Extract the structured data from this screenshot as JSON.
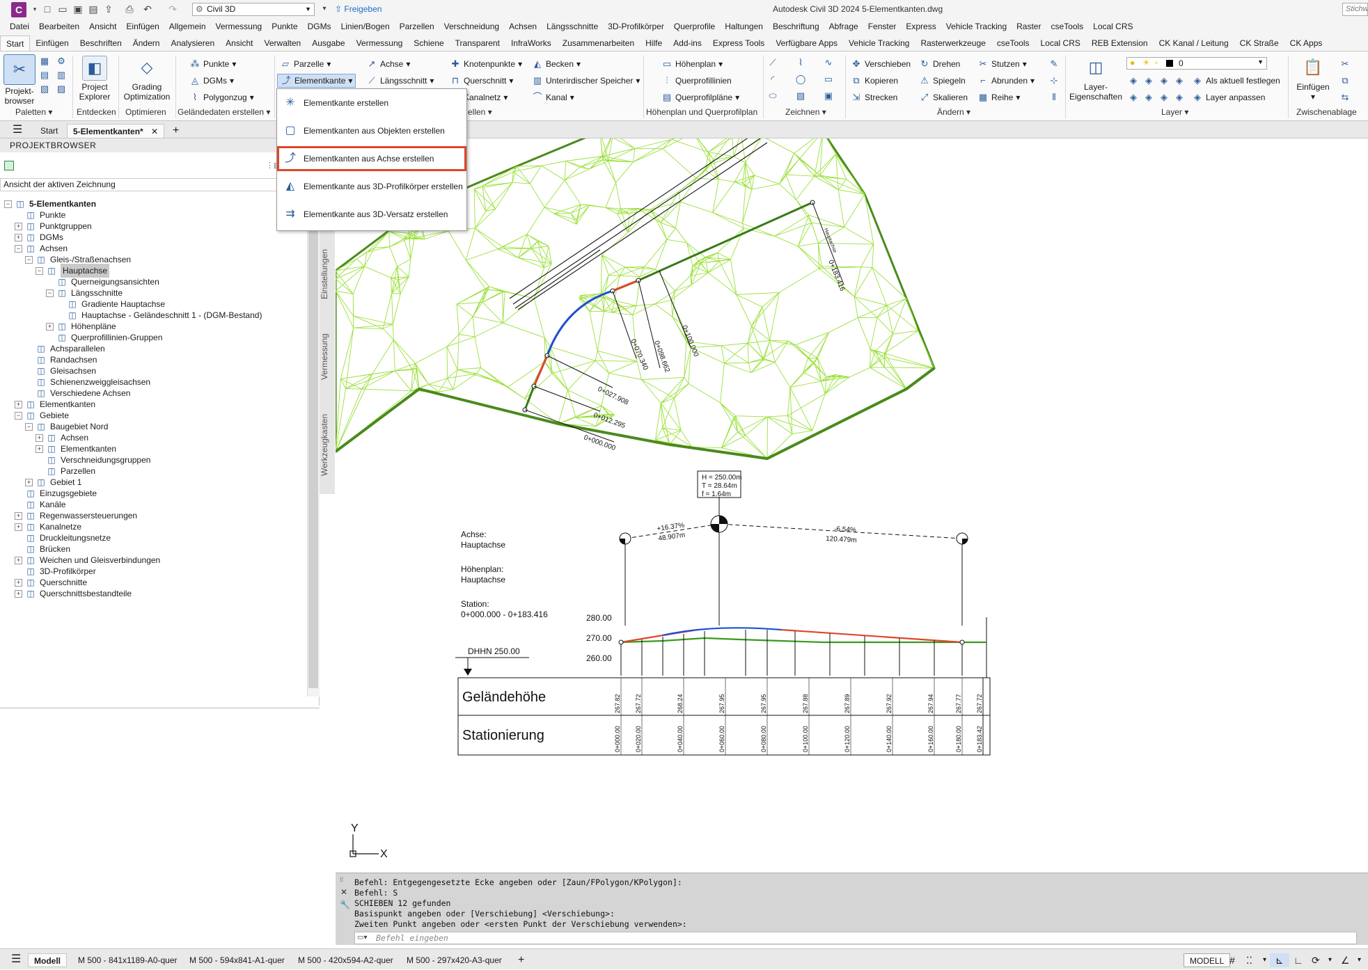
{
  "app": {
    "logo": "C",
    "workspace": "Civil 3D",
    "share_label": "Freigeben",
    "window_title": "Autodesk Civil 3D 2024   5-Elementkanten.dwg",
    "help_search_placeholder": "Stichwo"
  },
  "menubar": [
    "Datei",
    "Bearbeiten",
    "Ansicht",
    "Einfügen",
    "Allgemein",
    "Vermessung",
    "Punkte",
    "DGMs",
    "Linien/Bogen",
    "Parzellen",
    "Verschneidung",
    "Achsen",
    "Längsschnitte",
    "3D-Profilkörper",
    "Querprofile",
    "Haltungen",
    "Beschriftung",
    "Abfrage",
    "Fenster",
    "Express",
    "Vehicle Tracking",
    "Raster",
    "cseTools",
    "Local CRS"
  ],
  "ribbon_tabs": [
    "Start",
    "Einfügen",
    "Beschriften",
    "Ändern",
    "Analysieren",
    "Ansicht",
    "Verwalten",
    "Ausgabe",
    "Vermessung",
    "Schiene",
    "Transparent",
    "InfraWorks",
    "Zusammenarbeiten",
    "Hilfe",
    "Add-ins",
    "Express Tools",
    "Verfügbare Apps",
    "Vehicle Tracking",
    "Rasterwerkzeuge",
    "cseTools",
    "Local CRS",
    "REB Extension",
    "CK Kanal / Leitung",
    "CK Straße",
    "CK Apps"
  ],
  "ribbon": {
    "paletten": {
      "big_label_1": "Projekt-",
      "big_label_2": "browser",
      "panel": "Paletten"
    },
    "entdecken": {
      "big_label_1": "Project",
      "big_label_2": "Explorer",
      "panel": "Entdecken"
    },
    "optimieren": {
      "big_label_1": "Grading",
      "big_label_2": "Optimization",
      "panel": "Optimieren"
    },
    "gelaende": {
      "punkte": "Punkte",
      "dgms": "DGMs",
      "polygonzug": "Polygonzug",
      "panel": "Geländedaten erstellen"
    },
    "entwurf": {
      "parzelle": "Parzelle",
      "elementkante": "Elementkante",
      "achse": "Achse",
      "laengsschnitt": "Längsschnitt",
      "knotenpunkte": "Knotenpunkte",
      "querschnitt": "Querschnitt",
      "kanalnetz": "Kanalnetz",
      "becken": "Becken",
      "speicher": "Unterirdischer Speicher",
      "kanal": "Kanal",
      "panel": "ellen"
    },
    "hoehenplan": {
      "hoehenplan": "Höhenplan",
      "querprofillinien": "Querprofillinien",
      "querprofilplaene": "Querprofilpläne",
      "panel": "Höhenplan und Querprofilplan"
    },
    "zeichnen": {
      "panel": "Zeichnen"
    },
    "aendern": {
      "verschieben": "Verschieben",
      "drehen": "Drehen",
      "stutzen": "Stutzen",
      "kopieren": "Kopieren",
      "spiegeln": "Spiegeln",
      "abrunden": "Abrunden",
      "strecken": "Strecken",
      "skalieren": "Skalieren",
      "reihe": "Reihe",
      "panel": "Ändern"
    },
    "layer": {
      "big_label_1": "Layer-",
      "big_label_2": "Eigenschaften",
      "current_layer": "0",
      "aktuell": "Als aktuell festlegen",
      "anpassen": "Layer anpassen",
      "panel": "Layer"
    },
    "zwischenablage": {
      "big_label": "Einfügen",
      "panel": "Zwischenablage"
    }
  },
  "doc_tabs": {
    "start": "Start",
    "active": "5-Elementkanten*"
  },
  "dropdown": [
    {
      "label": "Elementkante erstellen",
      "icon": "feature-line-icon",
      "highlighted": false
    },
    {
      "label": "Elementkanten aus Objekten erstellen",
      "icon": "from-objects-icon",
      "highlighted": false
    },
    {
      "label": "Elementkanten aus Achse erstellen",
      "icon": "from-alignment-icon",
      "highlighted": true
    },
    {
      "label": "Elementkante aus 3D-Profilkörper erstellen",
      "icon": "from-corridor-icon",
      "highlighted": false
    },
    {
      "label": "Elementkante aus 3D-Versatz erstellen",
      "icon": "from-offset-icon",
      "highlighted": false
    }
  ],
  "project_browser": {
    "title": "PROJEKTBROWSER",
    "view_label": "Ansicht der aktiven Zeichnung",
    "tree": [
      {
        "label": "5-Elementkanten",
        "level": 0,
        "exp": "-",
        "icon": "drawing-icon",
        "bold": true
      },
      {
        "label": "Punkte",
        "level": 1,
        "exp": "",
        "icon": "points-icon"
      },
      {
        "label": "Punktgruppen",
        "level": 1,
        "exp": "+",
        "icon": "point-groups-icon"
      },
      {
        "label": "DGMs",
        "level": 1,
        "exp": "+",
        "icon": "surfaces-icon"
      },
      {
        "label": "Achsen",
        "level": 1,
        "exp": "-",
        "icon": "alignments-icon"
      },
      {
        "label": "Gleis-/Straßenachsen",
        "level": 2,
        "exp": "-",
        "icon": "centerline-icon"
      },
      {
        "label": "Hauptachse",
        "level": 3,
        "exp": "-",
        "icon": "alignment-icon",
        "selected": true
      },
      {
        "label": "Querneigungsansichten",
        "level": 4,
        "exp": "",
        "icon": "superelevation-icon"
      },
      {
        "label": "Längsschnitte",
        "level": 4,
        "exp": "-",
        "icon": "profiles-icon"
      },
      {
        "label": "Gradiente Hauptachse",
        "level": 5,
        "exp": "",
        "icon": "profile-icon"
      },
      {
        "label": "Hauptachse - Geländeschnitt 1 - (DGM-Bestand)",
        "level": 5,
        "exp": "",
        "icon": "surface-profile-icon"
      },
      {
        "label": "Höhenpläne",
        "level": 4,
        "exp": "+",
        "icon": "profile-views-icon"
      },
      {
        "label": "Querprofillinien-Gruppen",
        "level": 4,
        "exp": "",
        "icon": "sample-line-icon"
      },
      {
        "label": "Achsparallelen",
        "level": 2,
        "exp": "",
        "icon": "offset-alignment-icon"
      },
      {
        "label": "Randachsen",
        "level": 2,
        "exp": "",
        "icon": "curb-return-icon"
      },
      {
        "label": "Gleisachsen",
        "level": 2,
        "exp": "",
        "icon": "rail-icon"
      },
      {
        "label": "Schienenzweiggleisachsen",
        "level": 2,
        "exp": "",
        "icon": "rail-branch-icon"
      },
      {
        "label": "Verschiedene Achsen",
        "level": 2,
        "exp": "",
        "icon": "misc-alignment-icon"
      },
      {
        "label": "Elementkanten",
        "level": 1,
        "exp": "+",
        "icon": "feature-lines-icon"
      },
      {
        "label": "Gebiete",
        "level": 1,
        "exp": "-",
        "icon": "sites-icon"
      },
      {
        "label": "Baugebiet Nord",
        "level": 2,
        "exp": "-",
        "icon": "site-icon"
      },
      {
        "label": "Achsen",
        "level": 3,
        "exp": "+",
        "icon": "alignments-icon"
      },
      {
        "label": "Elementkanten",
        "level": 3,
        "exp": "+",
        "icon": "feature-lines-icon"
      },
      {
        "label": "Verschneidungsgruppen",
        "level": 3,
        "exp": "",
        "icon": "grading-icon"
      },
      {
        "label": "Parzellen",
        "level": 3,
        "exp": "",
        "icon": "parcels-icon"
      },
      {
        "label": "Gebiet 1",
        "level": 2,
        "exp": "+",
        "icon": "site-icon"
      },
      {
        "label": "Einzugsgebiete",
        "level": 1,
        "exp": "",
        "icon": "catchment-icon"
      },
      {
        "label": "Kanäle",
        "level": 1,
        "exp": "",
        "icon": "channel-icon"
      },
      {
        "label": "Regenwassersteuerungen",
        "level": 1,
        "exp": "+",
        "icon": "stormwater-icon"
      },
      {
        "label": "Kanalnetze",
        "level": 1,
        "exp": "+",
        "icon": "pipe-network-icon"
      },
      {
        "label": "Druckleitungsnetze",
        "level": 1,
        "exp": "",
        "icon": "pressure-network-icon"
      },
      {
        "label": "Brücken",
        "level": 1,
        "exp": "",
        "icon": "bridge-icon"
      },
      {
        "label": "Weichen und Gleisverbindungen",
        "level": 1,
        "exp": "+",
        "icon": "turnout-icon"
      },
      {
        "label": "3D-Profilkörper",
        "level": 1,
        "exp": "",
        "icon": "corridor-icon"
      },
      {
        "label": "Querschnitte",
        "level": 1,
        "exp": "+",
        "icon": "assembly-icon"
      },
      {
        "label": "Querschnittsbestandteile",
        "level": 1,
        "exp": "+",
        "icon": "subassembly-icon"
      }
    ]
  },
  "vertical_tabs": [
    "Einstellungen",
    "Vermessung",
    "Werkzeugkasten"
  ],
  "drawing": {
    "plan_labels": [
      "0+000.000",
      "0+012.295",
      "0+027.908",
      "0+070.340",
      "0+098.662",
      "0+100.000",
      "0+183.416",
      "Hauptachse"
    ],
    "curve_box": [
      "H = 250.00m",
      "T = 28.64m",
      "f = 1.64m"
    ],
    "profile_meta": [
      "Achse:",
      "Hauptachse",
      "Höhenplan:",
      "Hauptachse",
      "Station:",
      "0+000.000 - 0+183.416"
    ],
    "grades": [
      {
        "pct": "+16.37%",
        "len": "48.907m"
      },
      {
        "pct": "-6.54%",
        "len": "120.479m"
      }
    ],
    "elev_labels": [
      "280.00",
      "270.00",
      "260.00"
    ],
    "datum": "DHHN 250.00",
    "band_titles": [
      "Geländehöhe",
      "Stationierung"
    ],
    "band_elevs": [
      "267.82",
      "267.72",
      "268.24",
      "267.95",
      "267.95",
      "267.88",
      "267.89",
      "267.92",
      "267.94",
      "267.77",
      "267.72"
    ],
    "band_stations": [
      "0+000.00",
      "0+020.00",
      "0+040.00",
      "0+060.00",
      "0+080.00",
      "0+100.00",
      "0+120.00",
      "0+140.00",
      "0+160.00",
      "0+180.00",
      "0+183.42"
    ],
    "ucs_x": "X",
    "ucs_y": "Y"
  },
  "command_window": {
    "lines": [
      "Befehl: Entgegengesetzte Ecke angeben oder [Zaun/FPolygon/KPolygon]:",
      "Befehl: S",
      "SCHIEBEN 12 gefunden",
      "Basispunkt angeben oder [Verschiebung] <Verschiebung>:",
      "Zweiten Punkt angeben oder <ersten Punkt der Verschiebung verwenden>:"
    ],
    "input_placeholder": "Befehl eingeben"
  },
  "statusbar": {
    "tabs": [
      "Modell",
      "M 500 - 841x1189-A0-quer",
      "M 500 - 594x841-A1-quer",
      "M 500 - 420x594-A2-quer",
      "M 500 - 297x420-A3-quer"
    ],
    "mode": "MODELL"
  },
  "colors": {
    "tin": "#9be03c",
    "tin_dark": "#4a8a1c",
    "curve_blue": "#1f4fd8",
    "tangent_red": "#e0452a",
    "highlight": "#e0452a"
  }
}
